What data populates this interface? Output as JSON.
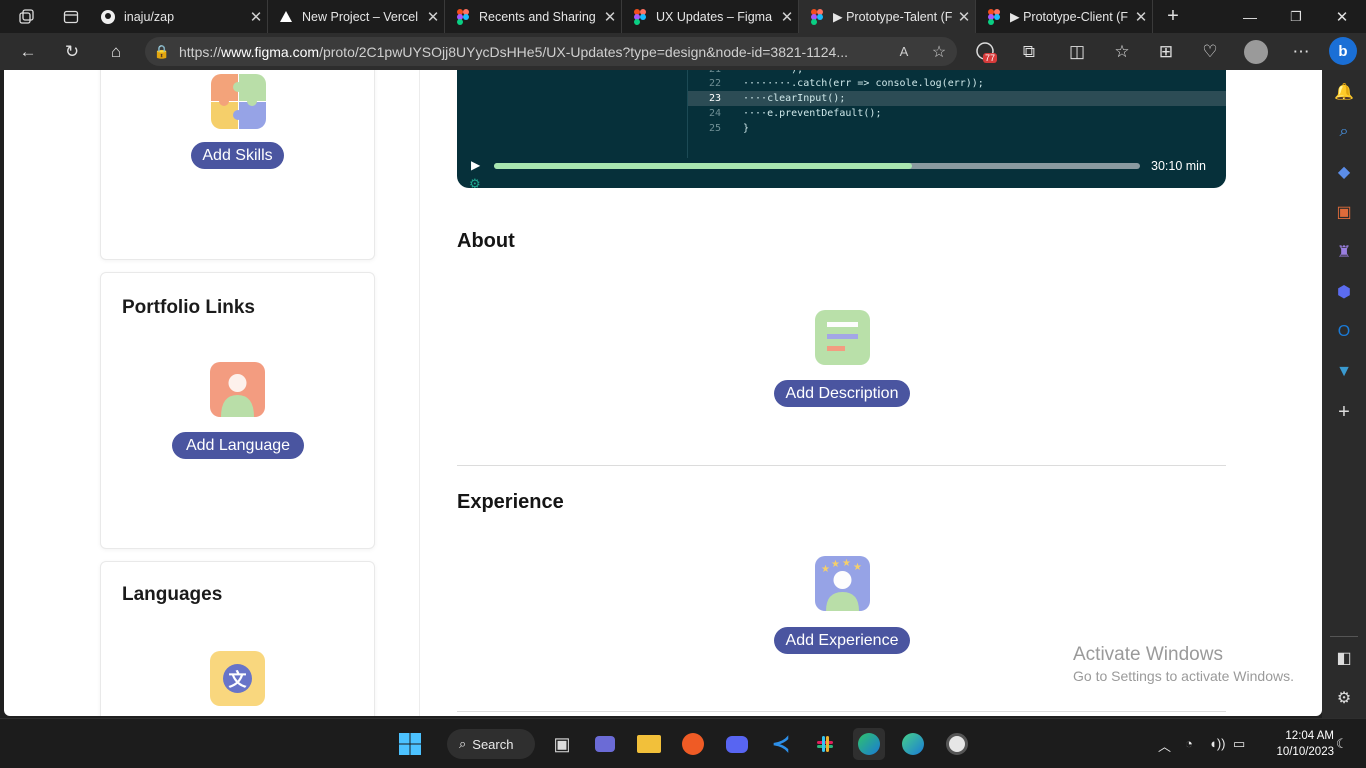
{
  "browser": {
    "tabs": [
      {
        "title": "inaju/zap",
        "icon": "github-icon"
      },
      {
        "title": "New Project – Vercel",
        "icon": "vercel-icon"
      },
      {
        "title": "Recents and Sharing",
        "icon": "figma-icon"
      },
      {
        "title": "UX Updates – Figma",
        "icon": "figma-icon"
      },
      {
        "title": "▶ Prototype-Talent (F",
        "icon": "figma-icon"
      },
      {
        "title": "▶ Prototype-Client (F",
        "icon": "figma-icon"
      }
    ],
    "address_prefix": "https://",
    "address_domain": "www.figma.com",
    "address_rest": "/proto/2C1pwUYSOjj8UYycDsHHe5/UX-Updates?type=design&node-id=3821-1124...",
    "extension_badge": "77"
  },
  "left_panel": {
    "skills_button": "Add Skills",
    "portfolio_title": "Portfolio Links",
    "language_button": "Add Language",
    "languages_title": "Languages",
    "language_glyph": "文"
  },
  "video": {
    "code_lines": [
      {
        "num": "22",
        "text": "········.catch(err => console.log(err));"
      },
      {
        "num": "23",
        "text": "····clearInput();"
      },
      {
        "num": "24",
        "text": "····e.preventDefault();"
      },
      {
        "num": "25",
        "text": "}"
      }
    ],
    "duration": "30:10 min",
    "progress": 0.647
  },
  "about": {
    "title": "About",
    "button": "Add Description"
  },
  "experience": {
    "title": "Experience",
    "button": "Add Experience"
  },
  "watermark": {
    "line1": "Activate Windows",
    "line2": "Go to Settings to activate Windows."
  },
  "taskbar": {
    "search_label": "Search",
    "time": "12:04 AM",
    "date": "10/10/2023"
  },
  "colors": {
    "accent": "#4a55a0",
    "video_bg": "#06303a",
    "progress_fill": "#a8e6b0"
  }
}
